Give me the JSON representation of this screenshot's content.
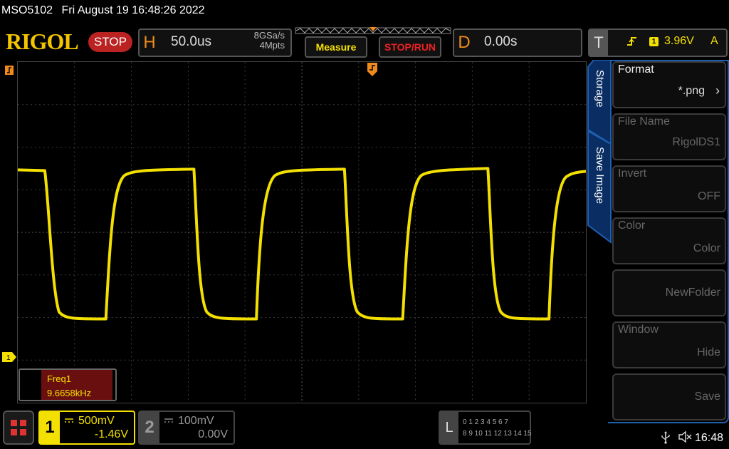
{
  "status_line": {
    "model": "MSO5102",
    "datetime": "Fri August 19 16:48:26 2022"
  },
  "header": {
    "brand": "RIGOL",
    "run_state": "STOP",
    "horizontal": {
      "letter": "H",
      "timebase": "50.0us",
      "sample_rate": "8GSa/s",
      "memory_depth": "4Mpts"
    },
    "measure_label": "Measure",
    "stoprun_label": "STOP/RUN",
    "delay": {
      "letter": "D",
      "value": "0.00s"
    },
    "trigger": {
      "letter": "T",
      "channel": "1",
      "level": "3.96V",
      "mode": "A"
    }
  },
  "measurement": {
    "name": "Freq1",
    "value": "9.6658kHz"
  },
  "ch1_marker_label": "1",
  "side_menu": {
    "tabs": [
      "Storage",
      "Save Image"
    ],
    "items": [
      {
        "title": "Format",
        "value": "*.png",
        "enabled": true,
        "has_arrow": true
      },
      {
        "title": "File Name",
        "value": "RigolDS1",
        "enabled": false
      },
      {
        "title": "Invert",
        "value": "OFF",
        "enabled": false
      },
      {
        "title": "Color",
        "value": "Color",
        "enabled": false
      },
      {
        "title": "",
        "value": "NewFolder",
        "enabled": false
      },
      {
        "title": "Window",
        "value": "Hide",
        "enabled": false
      },
      {
        "title": "",
        "value": "Save",
        "enabled": false
      }
    ]
  },
  "channels": {
    "ch1": {
      "number": "1",
      "scale": "500mV",
      "offset": "-1.46V"
    },
    "ch2": {
      "number": "2",
      "scale": "100mV",
      "offset": "0.00V"
    }
  },
  "logic": {
    "letter": "L",
    "row1": "0 1 2 3   4 5 6 7",
    "row2": "8  9 10 11 12 13 14 15"
  },
  "system_tray": {
    "time": "16:48"
  },
  "colors": {
    "ch1": "#f3e000",
    "accent": "#f08a1c",
    "stop": "#b22222",
    "menu_border": "#1e5fb0"
  }
}
